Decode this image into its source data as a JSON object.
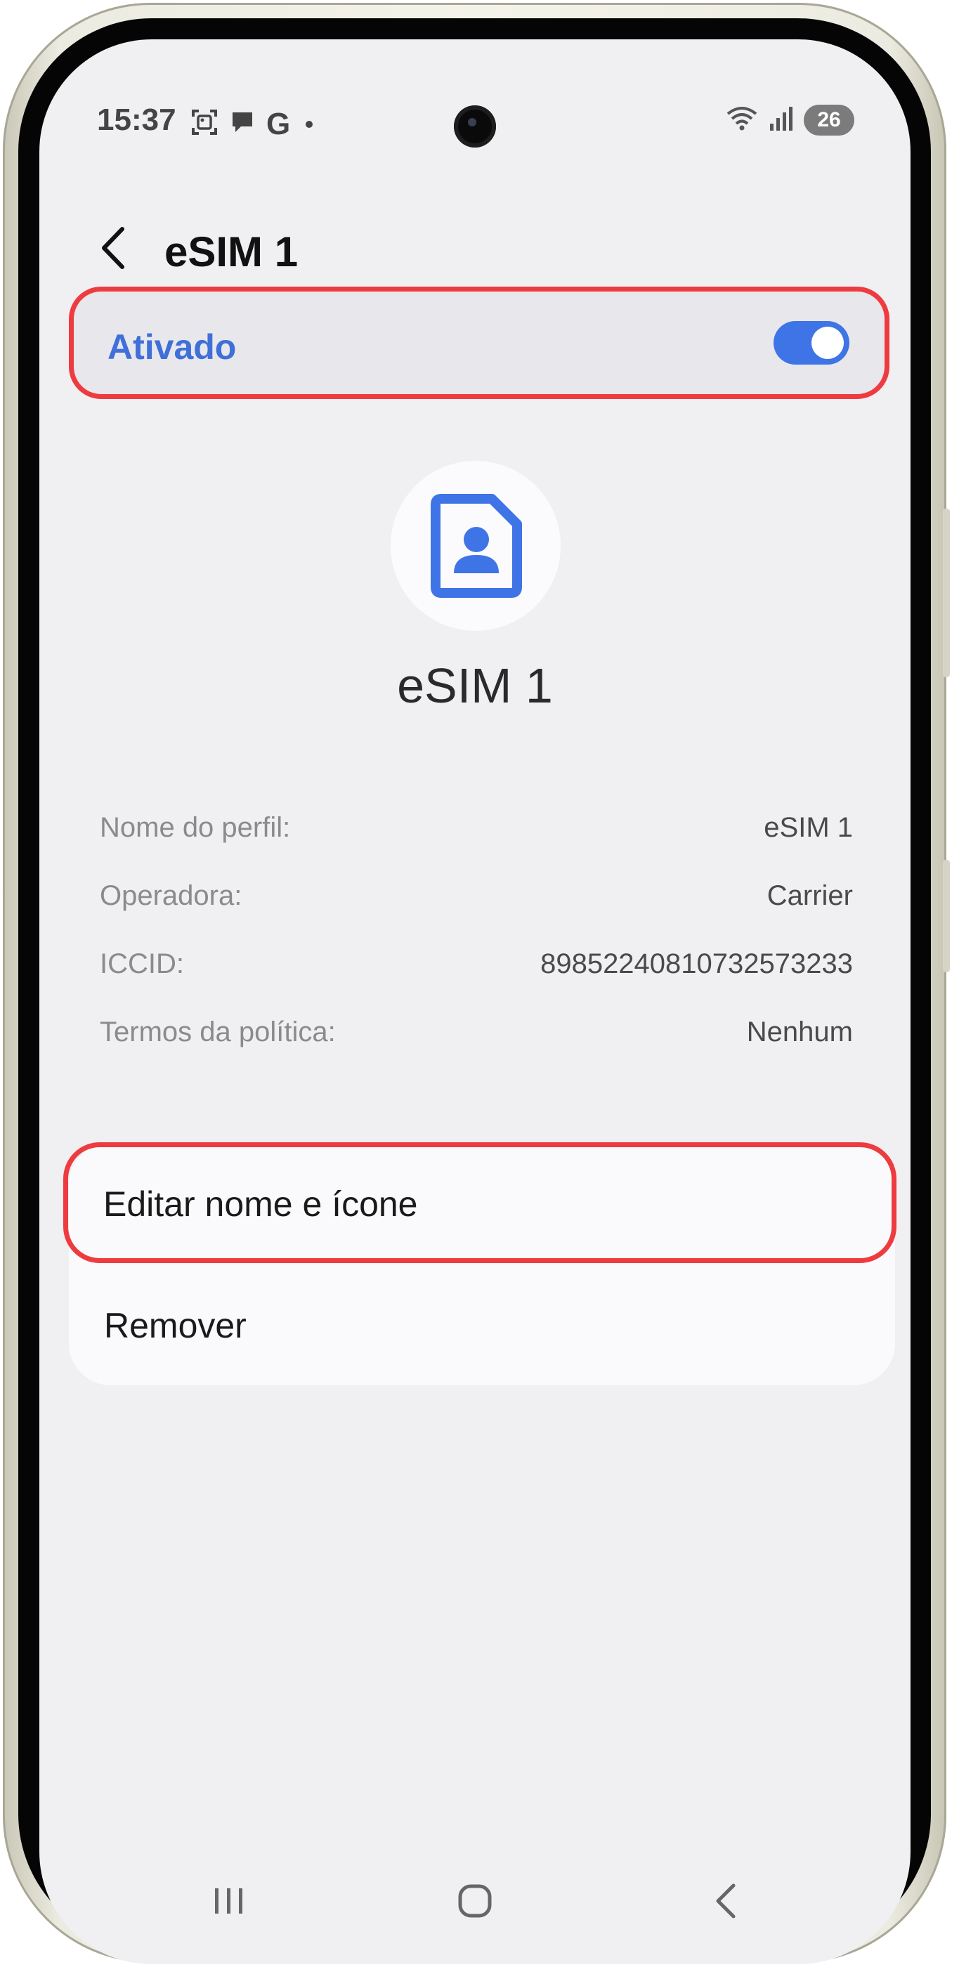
{
  "status_bar": {
    "time": "15:37",
    "notification_icons": [
      "screenshot-icon",
      "chat-bubble-icon",
      "google-icon",
      "dot-icon"
    ],
    "google_letter": "G",
    "battery_level": "26"
  },
  "header": {
    "title": "eSIM 1"
  },
  "toggle": {
    "label": "Ativado",
    "on": true,
    "accent": "#3e74e6"
  },
  "profile": {
    "name": "eSIM 1",
    "icon": "sim-contact-icon"
  },
  "info": {
    "rows": [
      {
        "label": "Nome do perfil:",
        "value": "eSIM 1"
      },
      {
        "label": "Operadora:",
        "value": "Carrier"
      },
      {
        "label": "ICCID:",
        "value": "89852240810732573233"
      },
      {
        "label": "Termos da política:",
        "value": "Nenhum"
      }
    ]
  },
  "actions": {
    "edit_label": "Editar nome e ícone",
    "remove_label": "Remover"
  },
  "highlight_color": "#ee3b3f",
  "nav": {
    "icons": [
      "recents-icon",
      "home-icon",
      "back-icon"
    ]
  }
}
